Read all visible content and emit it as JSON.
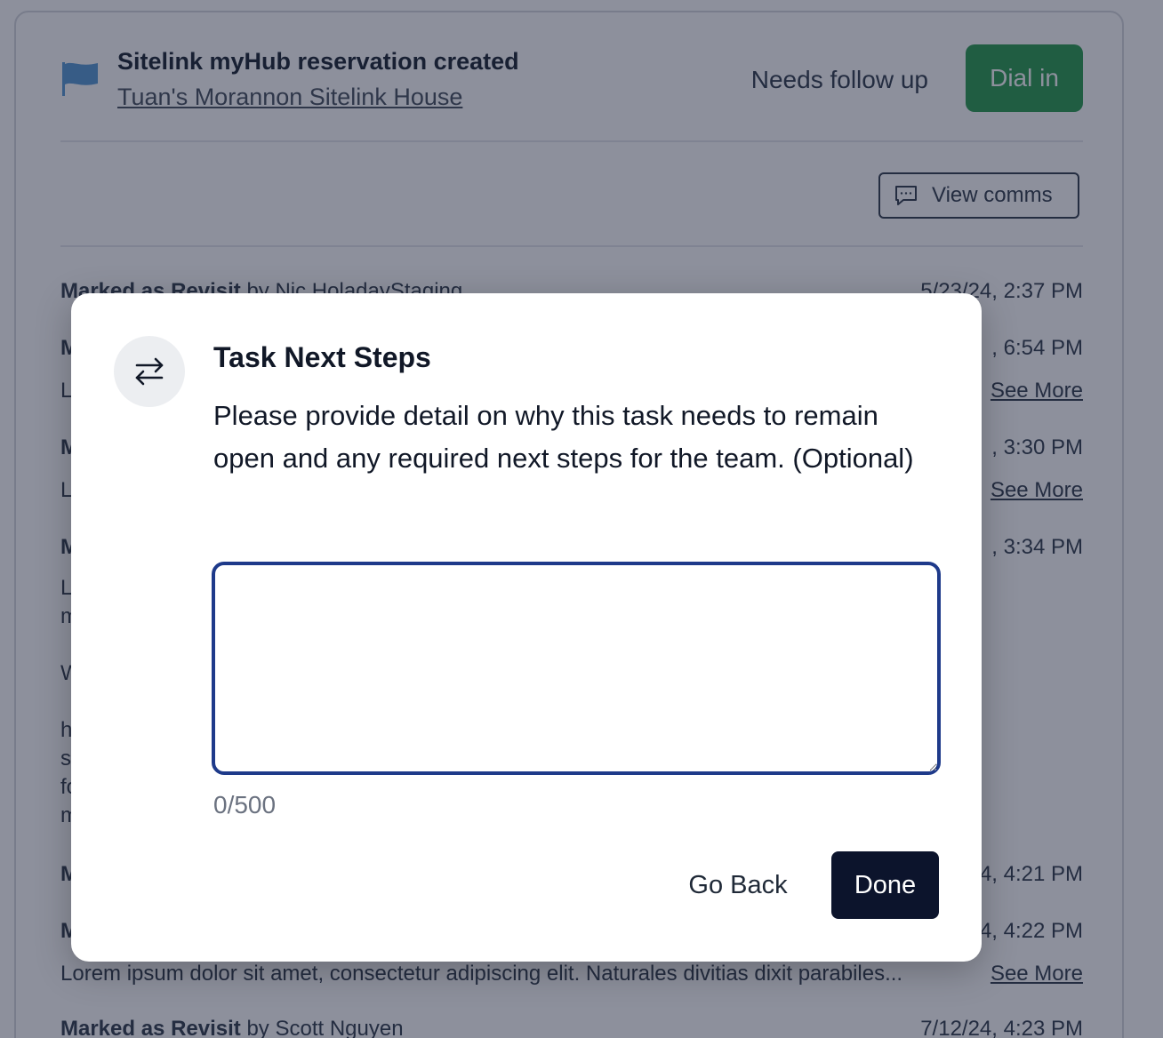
{
  "task": {
    "title": "Sitelink myHub reservation created",
    "location_link": "Tuan's Morannon Sitelink House",
    "status": "Needs follow up",
    "dial_label": "Dial in",
    "view_comms_label": "View comms"
  },
  "activity": [
    {
      "action": "Marked as Revisit",
      "by": "by Nic HoladayStaging",
      "time": "5/23/24, 2:37 PM"
    },
    {
      "action": "M",
      "by": "",
      "time": ", 6:54 PM",
      "body": "L",
      "see_more": "See More"
    },
    {
      "action": "M",
      "by": "",
      "time": ", 3:30 PM",
      "body": "L",
      "see_more": "See More"
    },
    {
      "action": "M",
      "by": "",
      "time": ", 3:34 PM",
      "body_lines": [
        "L",
        "m",
        "",
        "W",
        "",
        "h",
        "s",
        "fo",
        "m"
      ]
    },
    {
      "action": "M",
      "by": "",
      "time": "4, 4:21 PM"
    },
    {
      "action": "M",
      "by": "",
      "time": "4, 4:22 PM",
      "body": "Lorem ipsum dolor sit amet, consectetur adipiscing elit. Naturales divitias dixit parabiles...",
      "see_more": "See More"
    },
    {
      "action": "Marked as Revisit",
      "by": "by Scott Nguyen",
      "time": "7/12/24, 4:23 PM"
    }
  ],
  "modal": {
    "title": "Task Next Steps",
    "description": "Please provide detail on why this task needs to remain open and any required next steps for the team. (Optional)",
    "input_value": "",
    "char_count": "0/500",
    "back_label": "Go Back",
    "done_label": "Done"
  },
  "colors": {
    "primary_dark": "#0c142c",
    "dial_green": "#2f9e54",
    "focus_ring": "#1e3a8a",
    "flag_blue": "#5b9bd5"
  },
  "icons": {
    "flag": "flag-icon",
    "comms": "chat-bubble-icon",
    "modal": "swap-arrows-icon"
  }
}
